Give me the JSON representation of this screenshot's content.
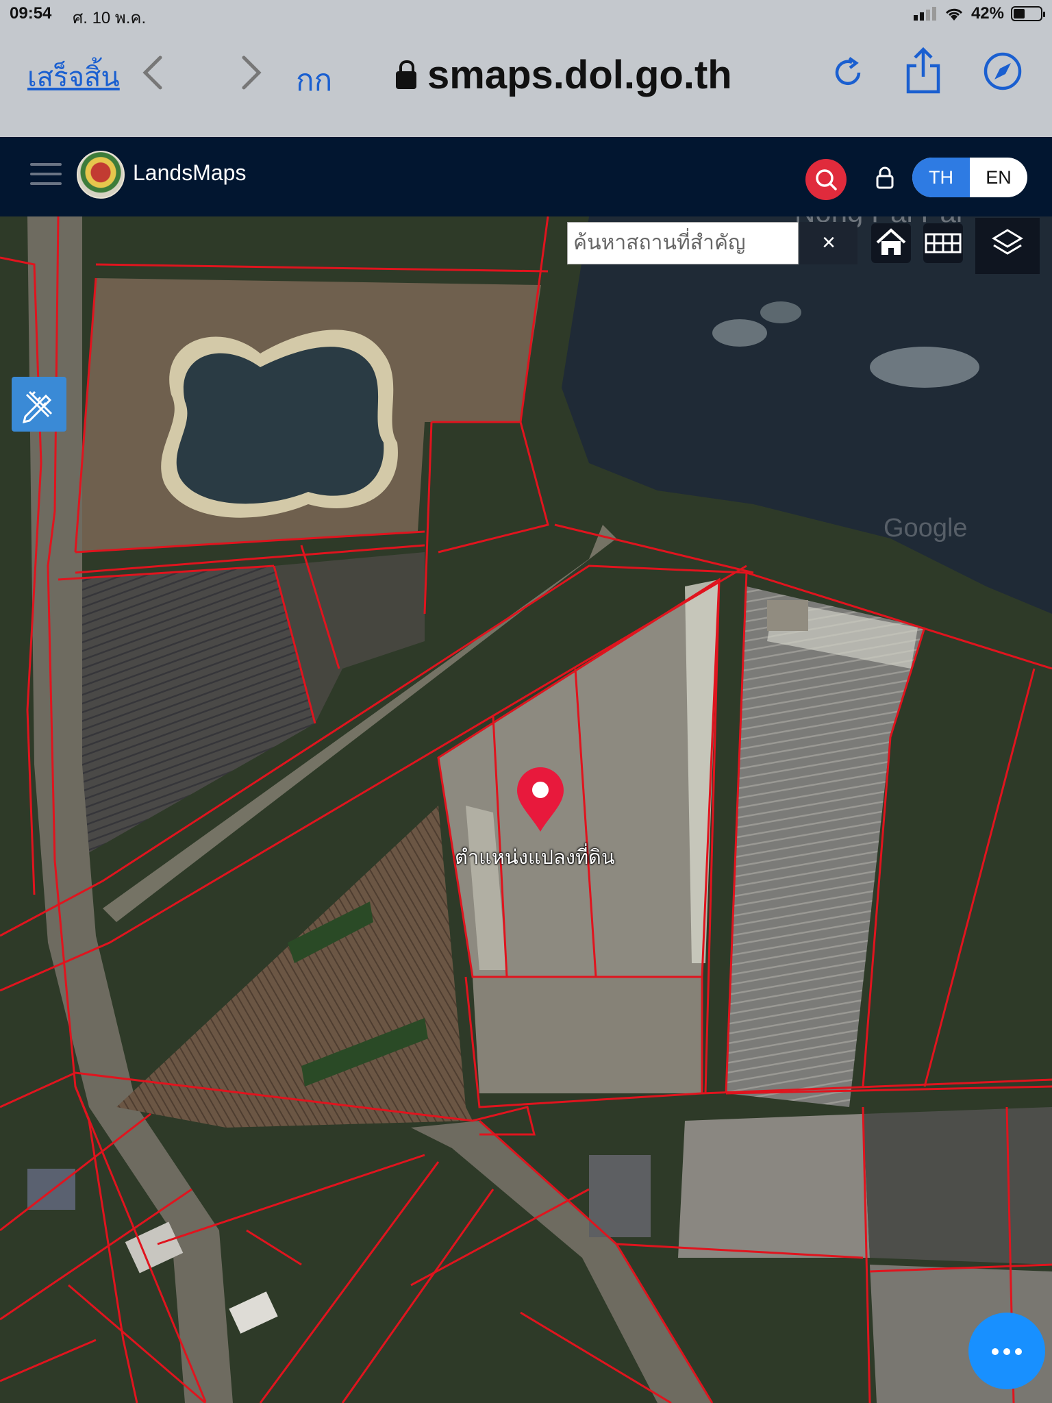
{
  "status_bar": {
    "time": "09:54",
    "date": "ศ. 10 พ.ค.",
    "battery": "42%"
  },
  "browser": {
    "done_label": "เสร็จสิ้น",
    "text_size_label": "กก",
    "url": "smaps.dol.go.th"
  },
  "app": {
    "brand": "LandsMaps",
    "lang_th": "TH",
    "lang_en": "EN",
    "active_lang": "TH"
  },
  "map": {
    "search": {
      "placeholder": "ค้นหาสถานที่สำคัญ",
      "value": ""
    },
    "clear_label": "×",
    "pin_label": "ตำแหน่งแปลงที่ดิน",
    "watermark_place": "Nong Pai Pai",
    "watermark_google": "Google",
    "parcel_line_color": "#e0141e",
    "accent_color": "#e02b3c"
  }
}
